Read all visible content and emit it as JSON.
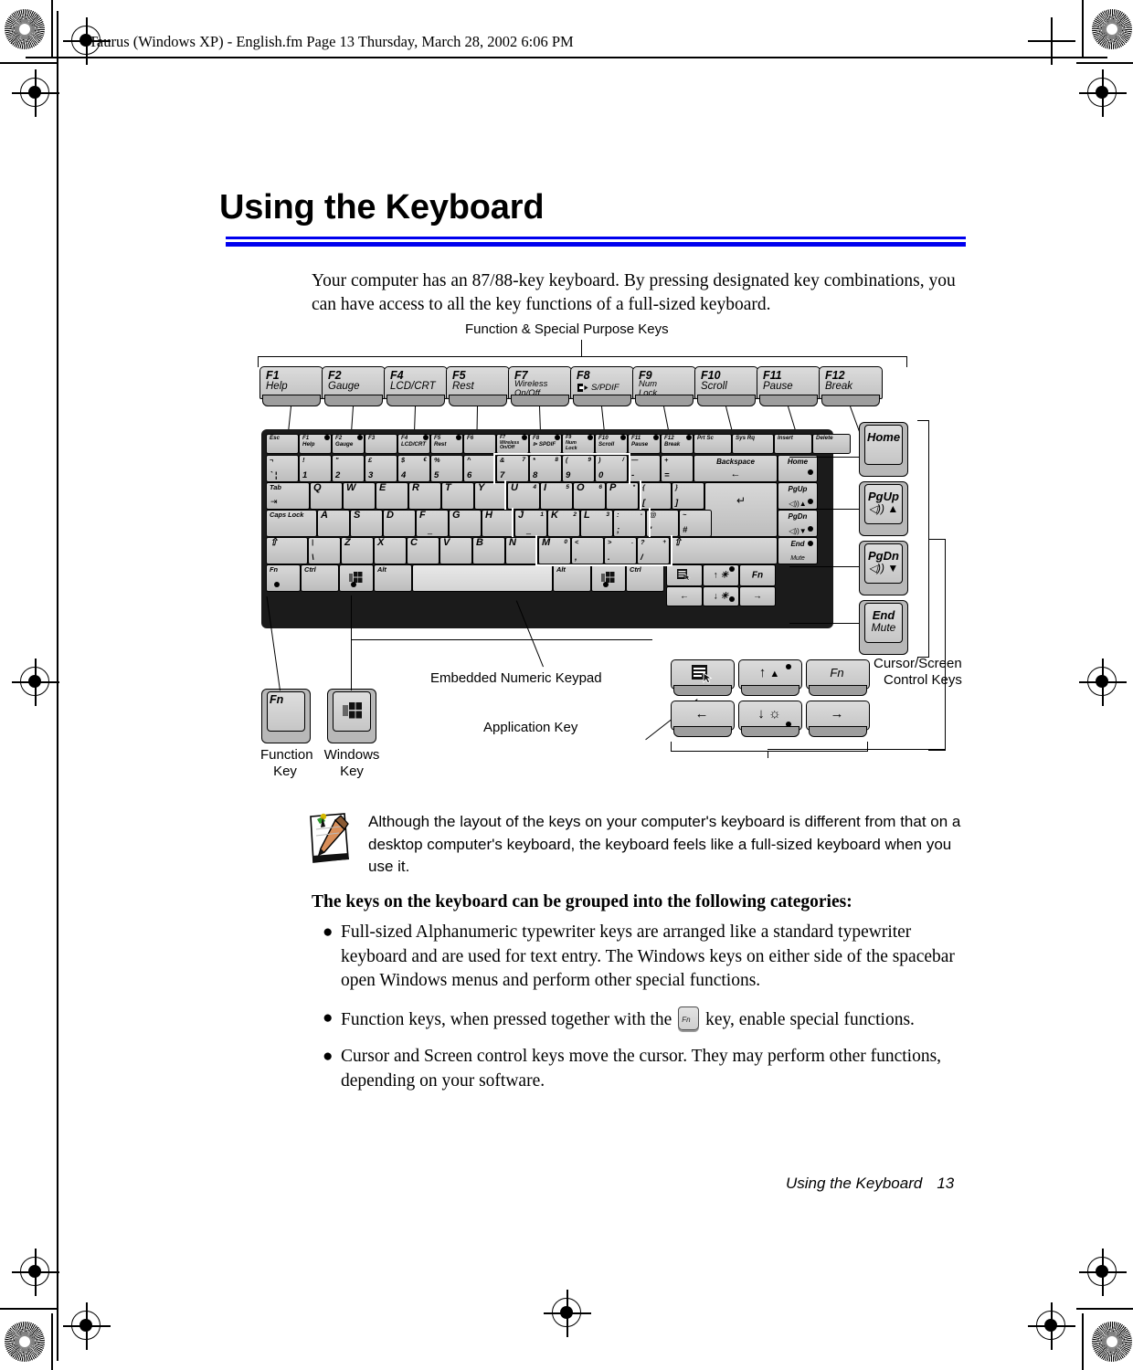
{
  "header": {
    "file_line": "Taurus (Windows XP) - English.fm  Page 13  Thursday, March 28, 2002  6:06 PM"
  },
  "title": "Using the Keyboard",
  "intro": "Your computer has an 87/88-key keyboard. By pressing designated key combinations, you can have access to all the key functions of a full-sized keyboard.",
  "colors": {
    "rule": "#0000EE",
    "key_face": "#D8D8D8",
    "chassis": "#1B1B1B",
    "keypad_outline": "#FFFFFF"
  },
  "diagram": {
    "labels": {
      "function_special": "Function & Special Purpose Keys",
      "embedded_keypad": "Embedded Numeric Keypad",
      "application_key": "Application Key",
      "function_key_l1": "Function",
      "function_key_l2": "Key",
      "windows_key_l1": "Windows",
      "windows_key_l2": "Key",
      "cursor_screen_l1": "Cursor/Screen",
      "cursor_screen_l2": "Control Keys"
    },
    "function_row": [
      {
        "name": "F1",
        "sub": "Help"
      },
      {
        "name": "F2",
        "sub": "Gauge"
      },
      {
        "name": "F4",
        "sub": "LCD/CRT"
      },
      {
        "name": "F5",
        "sub": "Rest"
      },
      {
        "name": "F7",
        "sub": "Wireless",
        "sub2": "On/Off"
      },
      {
        "name": "F8",
        "sub": "S/PDIF",
        "icon": "spdif-icon"
      },
      {
        "name": "F9",
        "sub": "Num",
        "sub2": "Lock"
      },
      {
        "name": "F10",
        "sub": "Scroll"
      },
      {
        "name": "F11",
        "sub": "Pause"
      },
      {
        "name": "F12",
        "sub": "Break"
      }
    ],
    "callout_keys": {
      "home": "Home",
      "pgup": "PgUp",
      "pgup_icon": "volume-up-icon",
      "pgdn": "PgDn",
      "pgdn_icon": "volume-down-icon",
      "end": "End",
      "end_sub": "Mute",
      "fn": "Fn",
      "windows_icon": "windows-logo-icon"
    },
    "cursor_cluster": [
      {
        "label": "",
        "icon": "application-menu-icon"
      },
      {
        "label": "",
        "icon": "up-brightness-icon"
      },
      {
        "label": "Fn",
        "icon": ""
      },
      {
        "label": "",
        "icon": "left-arrow-icon"
      },
      {
        "label": "",
        "icon": "down-brightness-icon"
      },
      {
        "label": "",
        "icon": "right-arrow-icon"
      }
    ],
    "keyboard_rows": {
      "row_f": [
        "Esc",
        "F1|Help",
        "F2|Gauge",
        "F3",
        "F4|LCD/CRT",
        "F5|Rest",
        "F6",
        "F7|Wireless On/Off",
        "F8|S/PDIF",
        "F9|Num Lock",
        "F10|Scroll",
        "F11|Pause",
        "F12|Break",
        "Prt Sc",
        "Sys Rq",
        "Insert",
        "Delete"
      ],
      "row_num": [
        "¬ `",
        "! 1",
        "\" 2",
        "£ 3",
        "$ € 4",
        "% 5",
        "^ 6",
        "& 7",
        "* 8",
        "( 9",
        ") 0",
        "— -",
        "+ =",
        "Backspace",
        "Home"
      ],
      "row_q": [
        "Tab",
        "Q",
        "W",
        "E",
        "R",
        "T",
        "Y",
        "U",
        "I",
        "O",
        "P",
        "{ [",
        "} ]",
        "Enter",
        "PgUp"
      ],
      "row_a": [
        "Caps Lock",
        "A",
        "S",
        "D",
        "F",
        "G",
        "H",
        "J",
        "K",
        "L",
        ": ;",
        "@ '",
        "~ #",
        "PgDn"
      ],
      "row_z": [
        "Shift",
        "| \\",
        "Z",
        "X",
        "C",
        "V",
        "B",
        "N",
        "M",
        "< ,",
        "> .",
        "? /",
        "Shift",
        "End Mute"
      ],
      "row_b": [
        "Fn",
        "Ctrl",
        "Windows",
        "Alt",
        "Space",
        "Alt",
        "Windows",
        "Ctrl"
      ]
    }
  },
  "note": {
    "icon": "notepad-pencil-icon",
    "text": "Although the layout of the keys on your computer's keyboard is different from that on a desktop computer's keyboard, the keyboard feels like a full-sized keyboard when you use it."
  },
  "lead_in": "The keys on the keyboard can be grouped into the following categories:",
  "bullets": [
    {
      "pre": "Full-sized Alphanumeric typewriter keys are arranged like a standard typewriter keyboard and are used for text entry. The Windows keys on either side of the spacebar open Windows menus and perform other special functions.",
      "post": "",
      "key": ""
    },
    {
      "pre": "Function keys, when pressed together with the ",
      "key": "Fn",
      "post": " key, enable special functions."
    },
    {
      "pre": "Cursor and Screen control keys move the cursor. They may perform other functions, depending on your software.",
      "post": "",
      "key": ""
    }
  ],
  "footer": {
    "chapter": "Using the Keyboard",
    "page": "13"
  }
}
